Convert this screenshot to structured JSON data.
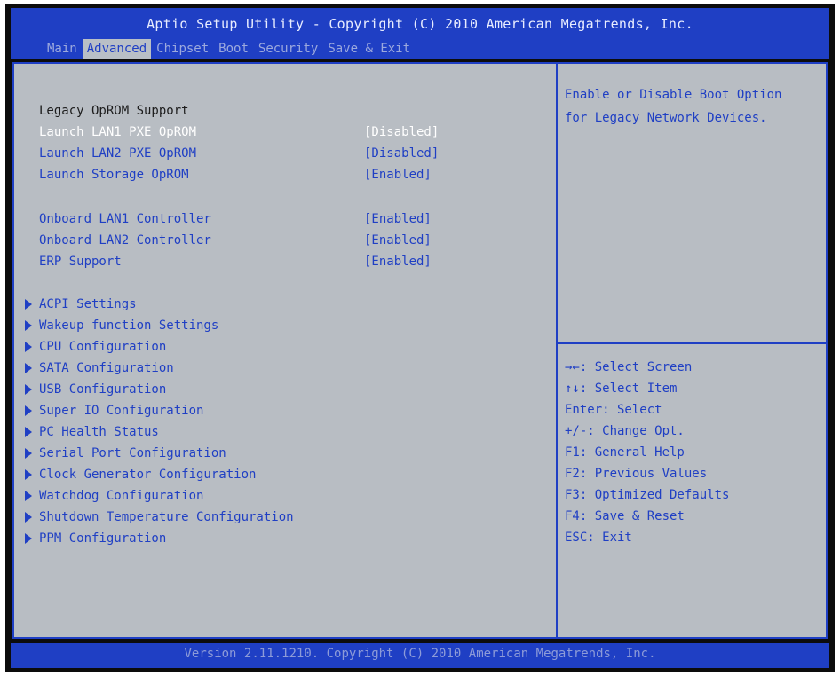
{
  "header": {
    "title": "Aptio Setup Utility - Copyright (C) 2010 American Megatrends, Inc.",
    "tabs": [
      "Main",
      "Advanced",
      "Chipset",
      "Boot",
      "Security",
      "Save & Exit"
    ],
    "active_tab": "Advanced"
  },
  "settings": {
    "section_heading": "Legacy OpROM Support",
    "items": [
      {
        "label": "Launch LAN1 PXE OpROM",
        "value": "[Disabled]"
      },
      {
        "label": "Launch LAN2 PXE OpROM",
        "value": "[Disabled]"
      },
      {
        "label": "Launch Storage OpROM",
        "value": "[Enabled]"
      },
      {
        "label": "Onboard LAN1 Controller",
        "value": "[Enabled]"
      },
      {
        "label": "Onboard LAN2 Controller",
        "value": "[Enabled]"
      },
      {
        "label": "ERP Support",
        "value": "[Enabled]"
      }
    ],
    "submenus": [
      "ACPI Settings",
      "Wakeup function Settings",
      "CPU Configuration",
      "SATA Configuration",
      "USB Configuration",
      "Super IO Configuration",
      "PC Health Status",
      "Serial Port Configuration",
      "Clock Generator Configuration",
      "Watchdog Configuration",
      "Shutdown Temperature Configuration",
      "PPM Configuration"
    ]
  },
  "help": {
    "text": "Enable or Disable Boot Option\nfor Legacy Network Devices.",
    "keys": [
      "→←: Select Screen",
      "↑↓: Select Item",
      "Enter: Select",
      "+/-: Change Opt.",
      "F1: General Help",
      "F2: Previous Values",
      "F3: Optimized Defaults",
      "F4: Save & Reset",
      "ESC: Exit"
    ]
  },
  "footer": {
    "text": "Version 2.11.1210. Copyright (C) 2010 American Megatrends, Inc."
  },
  "colors": {
    "bios_blue": "#1f3fc4",
    "panel_gray": "#b8bdc3",
    "highlight_white": "#ffffff"
  }
}
